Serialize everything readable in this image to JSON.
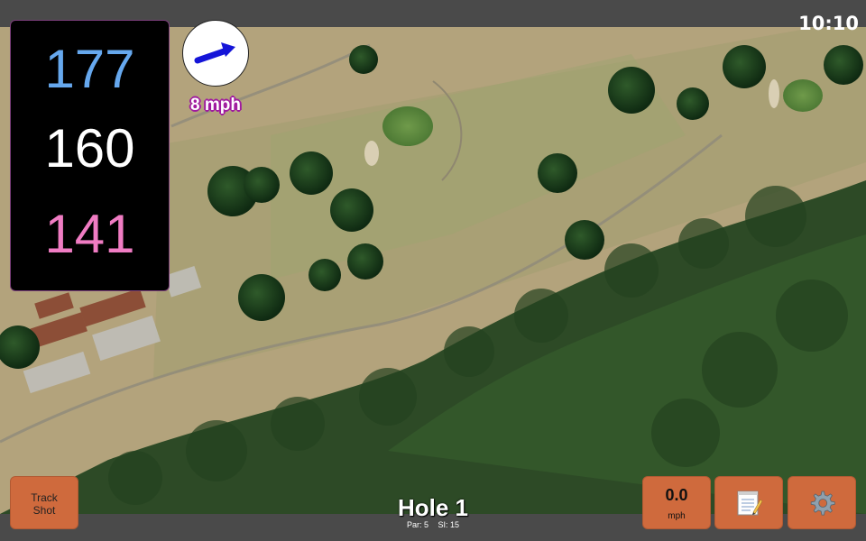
{
  "status_bar": {
    "time": "10:10"
  },
  "distances": {
    "back": "177",
    "center": "160",
    "front": "141"
  },
  "wind": {
    "speed": "8 mph",
    "icon": "arrow-icon",
    "arrow_color": "#1515d8"
  },
  "buttons": {
    "track_shot": {
      "line1": "Track",
      "line2": "Shot"
    },
    "speed": {
      "value": "0.0",
      "unit": "mph"
    },
    "notes": {
      "icon": "notepad-icon"
    },
    "settings": {
      "icon": "gear-icon"
    }
  },
  "hole": {
    "title": "Hole 1",
    "par": "Par: 5",
    "si": "SI: 15"
  },
  "colors": {
    "back_yardage": "#66a8ee",
    "center_yardage": "#ffffff",
    "front_yardage": "#f07cc3",
    "button_bg": "#cf6a3d",
    "wind_text_outline": "#a01ba0"
  }
}
